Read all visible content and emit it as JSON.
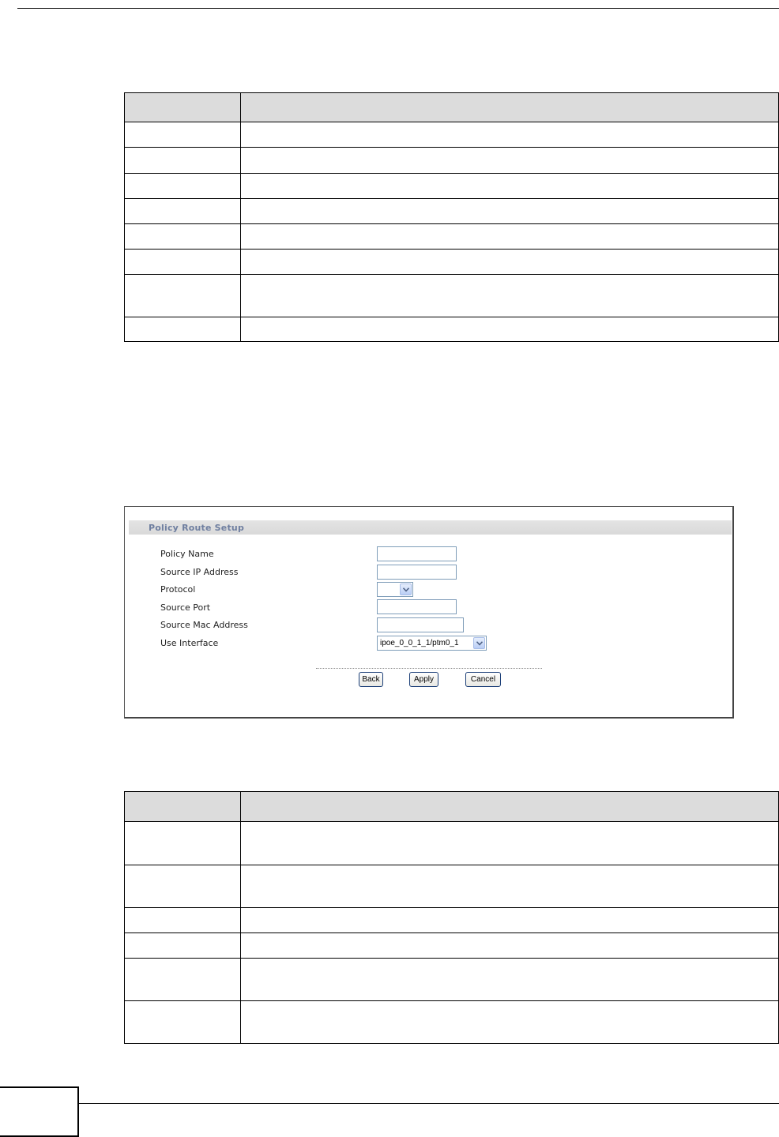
{
  "table1": {
    "headers": [
      "",
      ""
    ],
    "rows": [
      [
        "",
        ""
      ],
      [
        "",
        ""
      ],
      [
        "",
        ""
      ],
      [
        "",
        ""
      ],
      [
        "",
        ""
      ],
      [
        "",
        ""
      ],
      [
        "",
        ""
      ],
      [
        "",
        ""
      ]
    ]
  },
  "policy_route_screen": {
    "title": "Policy Route Setup",
    "fields": {
      "policy_name": {
        "label": "Policy Name",
        "value": ""
      },
      "source_ip": {
        "label": "Source IP Address",
        "value": ""
      },
      "protocol": {
        "label": "Protocol",
        "selected": ""
      },
      "source_port": {
        "label": "Source Port",
        "value": ""
      },
      "source_mac": {
        "label": "Source Mac Address",
        "value": ""
      },
      "use_interface": {
        "label": "Use Interface",
        "selected": "ipoe_0_0_1_1/ptm0_1"
      }
    },
    "buttons": {
      "back": "Back",
      "apply": "Apply",
      "cancel": "Cancel"
    }
  },
  "table2": {
    "headers": [
      "",
      ""
    ],
    "rows": [
      [
        "",
        ""
      ],
      [
        "",
        ""
      ],
      [
        "",
        ""
      ],
      [
        "",
        ""
      ],
      [
        "",
        ""
      ],
      [
        "",
        ""
      ]
    ]
  },
  "page": {
    "number": ""
  }
}
